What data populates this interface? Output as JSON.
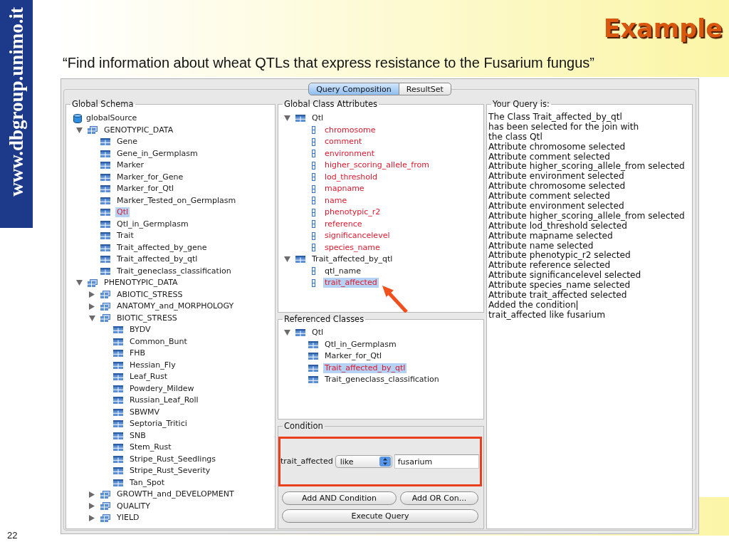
{
  "slide": {
    "site": "www.dbgroup.unimo.it",
    "title": "Example",
    "question": "“Find information about wheat QTLs that express resistance to the Fusarium fungus”",
    "page_number": "22"
  },
  "app": {
    "tabs": [
      {
        "label": "Query Composition",
        "selected": true
      },
      {
        "label": "ResultSet",
        "selected": false
      }
    ],
    "global_schema": {
      "title": "Global Schema",
      "tree": [
        {
          "label": "globalSource",
          "kind": "database",
          "selected": false,
          "chosen": false,
          "children": [
            {
              "label": "GENOTYPIC_DATA",
              "kind": "group",
              "expanded": true,
              "selected": false,
              "chosen": false,
              "children": [
                {
                  "label": "Gene",
                  "kind": "class",
                  "selected": false,
                  "chosen": false
                },
                {
                  "label": "Gene_in_Germplasm",
                  "kind": "class",
                  "selected": false,
                  "chosen": false
                },
                {
                  "label": "Marker",
                  "kind": "class",
                  "selected": false,
                  "chosen": false
                },
                {
                  "label": "Marker_for_Gene",
                  "kind": "class",
                  "selected": false,
                  "chosen": false
                },
                {
                  "label": "Marker_for_Qtl",
                  "kind": "class",
                  "selected": false,
                  "chosen": false
                },
                {
                  "label": "Marker_Tested_on_Germplasm",
                  "kind": "class",
                  "selected": false,
                  "chosen": false
                },
                {
                  "label": "Qtl",
                  "kind": "class",
                  "selected": true,
                  "chosen": true
                },
                {
                  "label": "Qtl_in_Germplasm",
                  "kind": "class",
                  "selected": false,
                  "chosen": false
                },
                {
                  "label": "Trait",
                  "kind": "class",
                  "selected": false,
                  "chosen": false
                },
                {
                  "label": "Trait_affected_by_gene",
                  "kind": "class",
                  "selected": false,
                  "chosen": false
                },
                {
                  "label": "Trait_affected_by_qtl",
                  "kind": "class",
                  "selected": false,
                  "chosen": false
                },
                {
                  "label": "Trait_geneclass_classification",
                  "kind": "class",
                  "selected": false,
                  "chosen": false
                }
              ]
            },
            {
              "label": "PHENOTYPIC_DATA",
              "kind": "group",
              "expanded": true,
              "selected": false,
              "chosen": false,
              "children": [
                {
                  "label": "ABIOTIC_STRESS",
                  "kind": "group",
                  "expanded": false,
                  "selected": false,
                  "chosen": false
                },
                {
                  "label": "ANATOMY_and_MORPHOLOGY",
                  "kind": "group",
                  "expanded": false,
                  "selected": false,
                  "chosen": false
                },
                {
                  "label": "BIOTIC_STRESS",
                  "kind": "group",
                  "expanded": true,
                  "selected": false,
                  "chosen": false,
                  "children": [
                    {
                      "label": "BYDV",
                      "kind": "class",
                      "selected": false,
                      "chosen": false
                    },
                    {
                      "label": "Common_Bunt",
                      "kind": "class",
                      "selected": false,
                      "chosen": false
                    },
                    {
                      "label": "FHB",
                      "kind": "class",
                      "selected": false,
                      "chosen": false
                    },
                    {
                      "label": "Hessian_Fly",
                      "kind": "class",
                      "selected": false,
                      "chosen": false
                    },
                    {
                      "label": "Leaf_Rust",
                      "kind": "class",
                      "selected": false,
                      "chosen": false
                    },
                    {
                      "label": "Powdery_Mildew",
                      "kind": "class",
                      "selected": false,
                      "chosen": false
                    },
                    {
                      "label": "Russian_Leaf_Roll",
                      "kind": "class",
                      "selected": false,
                      "chosen": false
                    },
                    {
                      "label": "SBWMV",
                      "kind": "class",
                      "selected": false,
                      "chosen": false
                    },
                    {
                      "label": "Septoria_Tritici",
                      "kind": "class",
                      "selected": false,
                      "chosen": false
                    },
                    {
                      "label": "SNB",
                      "kind": "class",
                      "selected": false,
                      "chosen": false
                    },
                    {
                      "label": "Stem_Rust",
                      "kind": "class",
                      "selected": false,
                      "chosen": false
                    },
                    {
                      "label": "Stripe_Rust_Seedlings",
                      "kind": "class",
                      "selected": false,
                      "chosen": false
                    },
                    {
                      "label": "Stripe_Rust_Severity",
                      "kind": "class",
                      "selected": false,
                      "chosen": false
                    },
                    {
                      "label": "Tan_Spot",
                      "kind": "class",
                      "selected": false,
                      "chosen": false
                    }
                  ]
                },
                {
                  "label": "GROWTH_and_DEVELOPMENT",
                  "kind": "group",
                  "expanded": false,
                  "selected": false,
                  "chosen": false
                },
                {
                  "label": "QUALITY",
                  "kind": "group",
                  "expanded": false,
                  "selected": false,
                  "chosen": false
                },
                {
                  "label": "YIELD",
                  "kind": "group",
                  "expanded": false,
                  "selected": false,
                  "chosen": false
                }
              ]
            }
          ]
        }
      ]
    },
    "class_attributes": {
      "title": "Global Class Attributes",
      "tree": [
        {
          "label": "Qtl",
          "kind": "class",
          "expanded": true,
          "selected": false,
          "chosen": false,
          "children": [
            {
              "label": "chromosome",
              "kind": "attribute",
              "selected": false,
              "chosen": true
            },
            {
              "label": "comment",
              "kind": "attribute",
              "selected": false,
              "chosen": true
            },
            {
              "label": "environment",
              "kind": "attribute",
              "selected": false,
              "chosen": true
            },
            {
              "label": "higher_scoring_allele_from",
              "kind": "attribute",
              "selected": false,
              "chosen": true
            },
            {
              "label": "lod_threshold",
              "kind": "attribute",
              "selected": false,
              "chosen": true
            },
            {
              "label": "mapname",
              "kind": "attribute",
              "selected": false,
              "chosen": true
            },
            {
              "label": "name",
              "kind": "attribute",
              "selected": false,
              "chosen": true
            },
            {
              "label": "phenotypic_r2",
              "kind": "attribute",
              "selected": false,
              "chosen": true
            },
            {
              "label": "reference",
              "kind": "attribute",
              "selected": false,
              "chosen": true
            },
            {
              "label": "significancelevel",
              "kind": "attribute",
              "selected": false,
              "chosen": true
            },
            {
              "label": "species_name",
              "kind": "attribute",
              "selected": false,
              "chosen": true
            }
          ]
        },
        {
          "label": "Trait_affected_by_qtl",
          "kind": "class",
          "expanded": true,
          "selected": false,
          "chosen": false,
          "children": [
            {
              "label": "qtl_name",
              "kind": "attribute",
              "selected": false,
              "chosen": false
            },
            {
              "label": "trait_affected",
              "kind": "attribute",
              "selected": true,
              "chosen": true
            }
          ]
        }
      ]
    },
    "referenced_classes": {
      "title": "Referenced Classes",
      "tree": [
        {
          "label": "Qtl",
          "kind": "class",
          "expanded": true,
          "selected": false,
          "chosen": false,
          "children": [
            {
              "label": "Qtl_in_Germplasm",
              "kind": "class",
              "selected": false,
              "chosen": false
            },
            {
              "label": "Marker_for_Qtl",
              "kind": "class",
              "selected": false,
              "chosen": false
            },
            {
              "label": "Trait_affected_by_qtl",
              "kind": "class",
              "selected": true,
              "chosen": true
            },
            {
              "label": "Trait_geneclass_classification",
              "kind": "class",
              "selected": false,
              "chosen": false
            }
          ]
        }
      ]
    },
    "condition": {
      "title": "Condition",
      "attribute": "trait_affected",
      "operator": "like",
      "value": "fusarium",
      "buttons": [
        {
          "label": "Add AND Condition"
        },
        {
          "label": "Add OR Con..."
        },
        {
          "label": "Execute Query"
        }
      ]
    },
    "query": {
      "title": "Your Query is:",
      "lines": [
        {
          "text": "The Class Trait_affected_by_qtl",
          "cursor": false
        },
        {
          "text": "has been selected for the join with",
          "cursor": false
        },
        {
          "text": "the class Qtl",
          "cursor": false
        },
        {
          "text": "Attribute chromosome selected",
          "cursor": false
        },
        {
          "text": "Attribute comment selected",
          "cursor": false
        },
        {
          "text": "Attribute higher_scoring_allele_from selected",
          "cursor": false
        },
        {
          "text": "Attribute environment selected",
          "cursor": false
        },
        {
          "text": "Attribute chromosome selected",
          "cursor": false
        },
        {
          "text": "Attribute comment selected",
          "cursor": false
        },
        {
          "text": "Attribute environment selected",
          "cursor": false
        },
        {
          "text": "Attribute higher_scoring_allele_from selected",
          "cursor": false
        },
        {
          "text": "Attribute lod_threshold selected",
          "cursor": false
        },
        {
          "text": "Attribute mapname selected",
          "cursor": false
        },
        {
          "text": "Attribute name selected",
          "cursor": false
        },
        {
          "text": "Attribute phenotypic_r2 selected",
          "cursor": false
        },
        {
          "text": "Attribute reference selected",
          "cursor": false
        },
        {
          "text": "Attribute significancelevel selected",
          "cursor": false
        },
        {
          "text": "Attribute species_name selected",
          "cursor": false
        },
        {
          "text": "Attribute trait_affected selected",
          "cursor": false
        },
        {
          "text": "Added the condition",
          "cursor": true
        },
        {
          "text": "trait_affected like fusarium",
          "cursor": false
        }
      ]
    }
  }
}
